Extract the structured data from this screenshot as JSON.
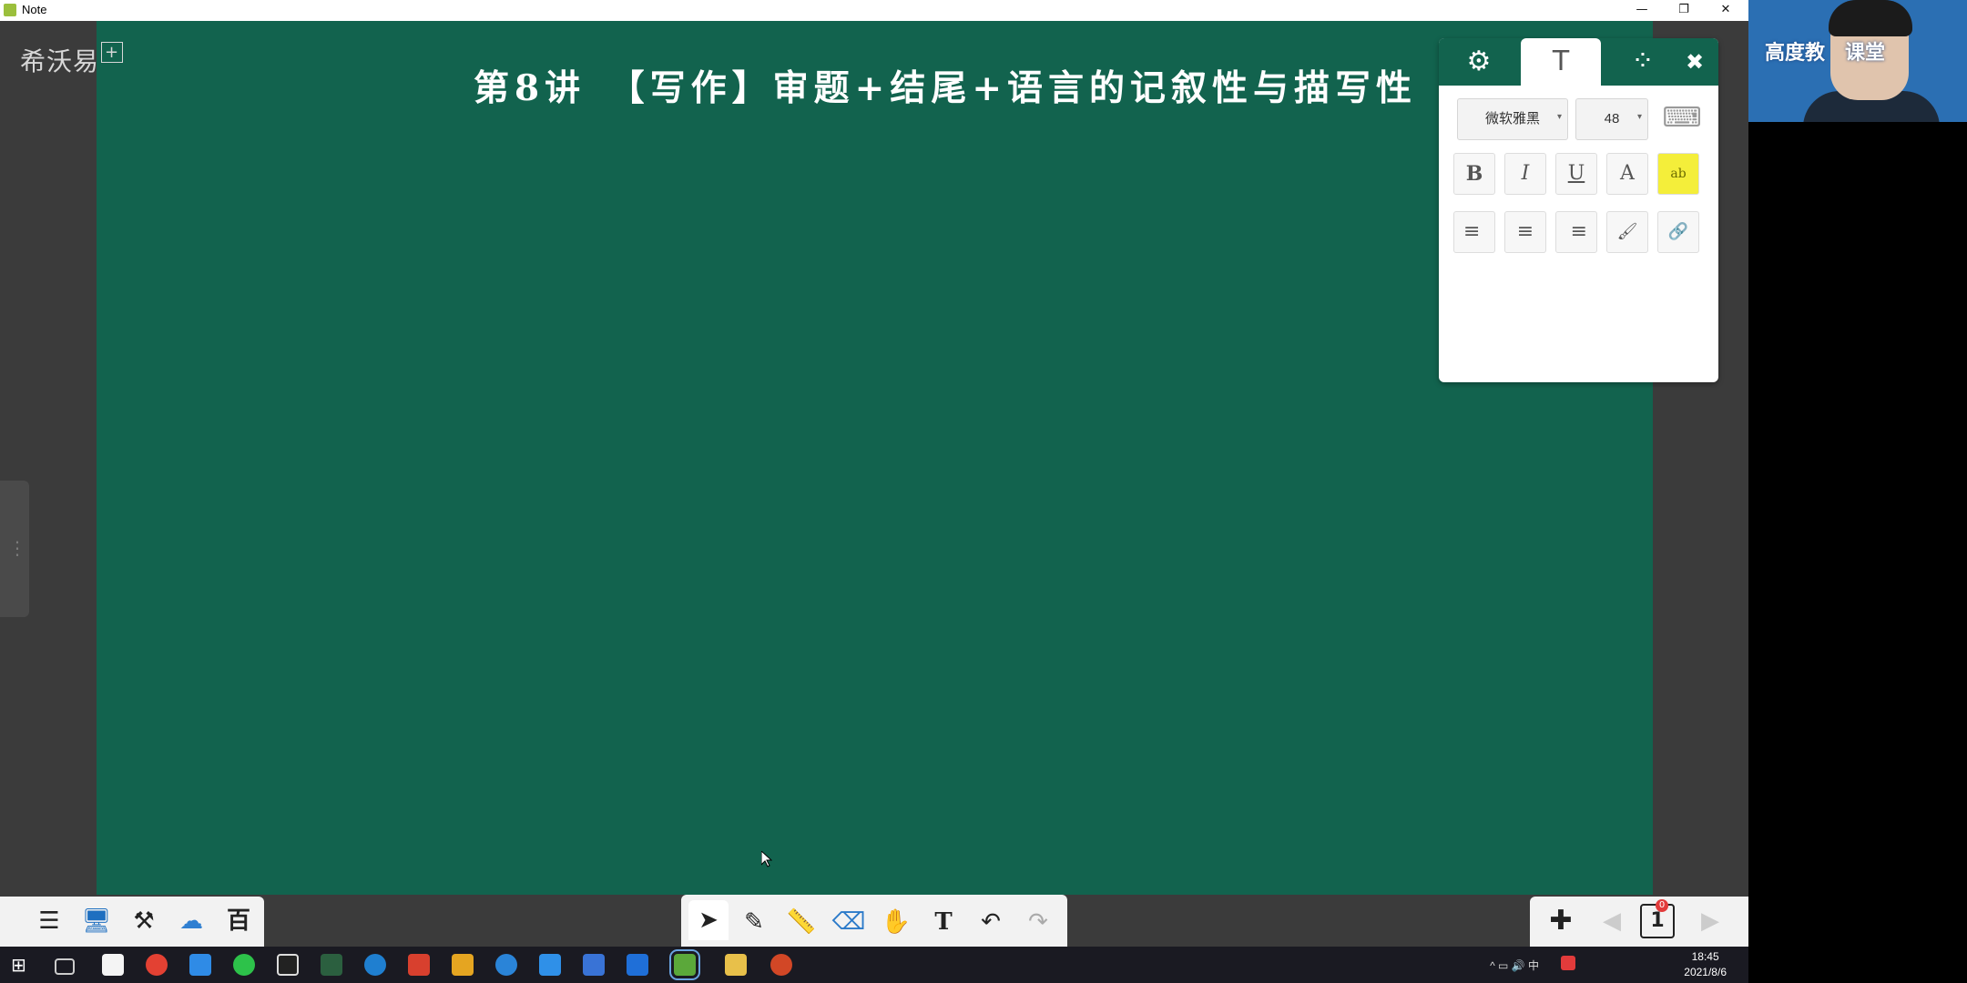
{
  "window": {
    "title": "Note",
    "controls": {
      "minimize": "—",
      "restore": "❐",
      "close": "✕"
    }
  },
  "board": {
    "logo_text": "希沃易",
    "logo_plus": "+",
    "lesson_title": "第8讲　【写作】审题+结尾+语言的记叙性与描写性"
  },
  "text_panel": {
    "tabs": [
      {
        "icon": "gear-icon",
        "glyph": "⚙"
      },
      {
        "icon": "text-icon",
        "glyph": "T"
      },
      {
        "icon": "dots-icon",
        "glyph": "⁘"
      }
    ],
    "close_glyph": "✖",
    "font_family": "微软雅黑",
    "font_size": "48",
    "keyboard_glyph": "⌨",
    "format_buttons": [
      "B",
      "I",
      "U",
      "A",
      "ab"
    ],
    "align_buttons": [
      "≡",
      "≡",
      "≡"
    ],
    "brush_glyph": "🖌",
    "link_glyph": "🔗"
  },
  "toolbar_left": [
    {
      "icon": "menu-icon",
      "glyph": "☰"
    },
    {
      "icon": "desktop-icon",
      "glyph": "🖥"
    },
    {
      "icon": "tools-icon",
      "glyph": "⚒"
    },
    {
      "icon": "cloud-icon",
      "glyph": "☁"
    },
    {
      "icon": "baidu-icon",
      "glyph": "百"
    }
  ],
  "toolbar_center": [
    {
      "icon": "select-icon",
      "glyph": "➤"
    },
    {
      "icon": "pen-icon",
      "glyph": "✎"
    },
    {
      "icon": "ruler-icon",
      "glyph": "📏"
    },
    {
      "icon": "eraser-icon",
      "glyph": "⌫"
    },
    {
      "icon": "hand-icon",
      "glyph": "✋"
    },
    {
      "icon": "text-tool-icon",
      "glyph": "T"
    },
    {
      "icon": "undo-icon",
      "glyph": "↶"
    },
    {
      "icon": "redo-icon",
      "glyph": "↷"
    }
  ],
  "toolbar_right": {
    "add_glyph": "✚",
    "prev_glyph": "◀",
    "page_number": "1",
    "page_badge": "0",
    "next_glyph": "▶"
  },
  "webcam": {
    "overlay_text": "高度教　课堂"
  },
  "taskbar": {
    "icons": [
      "windows-icon",
      "taskview-icon",
      "file-icon",
      "chrome-icon",
      "baidu-netdisk-icon",
      "wechat-icon",
      "qq-icon",
      "app-icon",
      "search-app-icon",
      "app-red-icon",
      "app-color-icon",
      "app-blue-icon",
      "app-blue2-icon",
      "app-blue3-icon",
      "app-blue4-icon",
      "easinote-icon",
      "folder-icon",
      "powerpoint-icon"
    ],
    "tray": "^  ▭  🔊  中",
    "time": "18:45",
    "date": "2021/8/6"
  }
}
